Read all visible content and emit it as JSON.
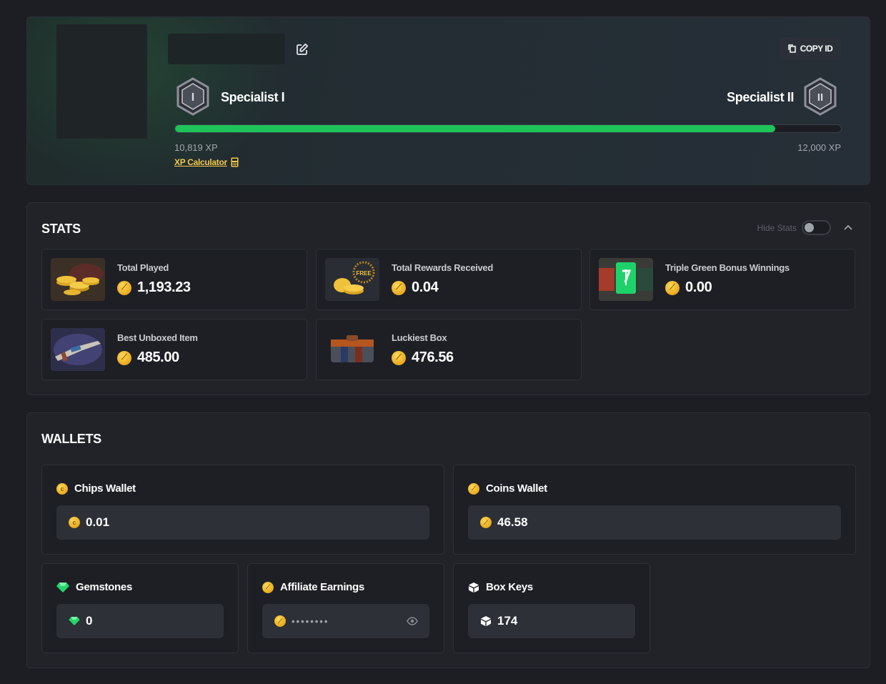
{
  "profile": {
    "copy_id_label": "COPY ID",
    "current_rank": {
      "name": "Specialist I",
      "numeral": "I"
    },
    "next_rank": {
      "name": "Specialist II",
      "numeral": "II"
    },
    "xp_current": "10,819 XP",
    "xp_target": "12,000 XP",
    "xp_progress": 0.9016,
    "xp_calculator_label": "XP Calculator"
  },
  "stats": {
    "title": "STATS",
    "hide_stats_label": "Hide Stats",
    "hide_stats_enabled": false,
    "cards": [
      {
        "label": "Total Played",
        "value": "1,193.23",
        "icon": "coins-pile-thumb"
      },
      {
        "label": "Total Rewards Received",
        "value": "0.04",
        "icon": "free-coins-thumb"
      },
      {
        "label": "Triple Green Bonus Winnings",
        "value": "0.00",
        "icon": "triple-green-thumb"
      },
      {
        "label": "Best Unboxed Item",
        "value": "485.00",
        "icon": "rifle-skin-thumb"
      },
      {
        "label": "Luckiest Box",
        "value": "476.56",
        "icon": "loot-box-thumb"
      }
    ]
  },
  "wallets": {
    "title": "WALLETS",
    "chips": {
      "label": "Chips Wallet",
      "value": "0.01"
    },
    "coins": {
      "label": "Coins Wallet",
      "value": "46.58"
    },
    "gemstones": {
      "label": "Gemstones",
      "value": "0"
    },
    "affiliate": {
      "label": "Affiliate Earnings",
      "masked_value": "••••••••"
    },
    "box_keys": {
      "label": "Box Keys",
      "value": "174"
    }
  },
  "colors": {
    "accent_green": "#1ec35a",
    "coin_gold": "#f2b51e",
    "link_yellow": "#f2c94c",
    "gem_green": "#22d66a",
    "background": "#1c1e24",
    "panel": "#212329"
  }
}
